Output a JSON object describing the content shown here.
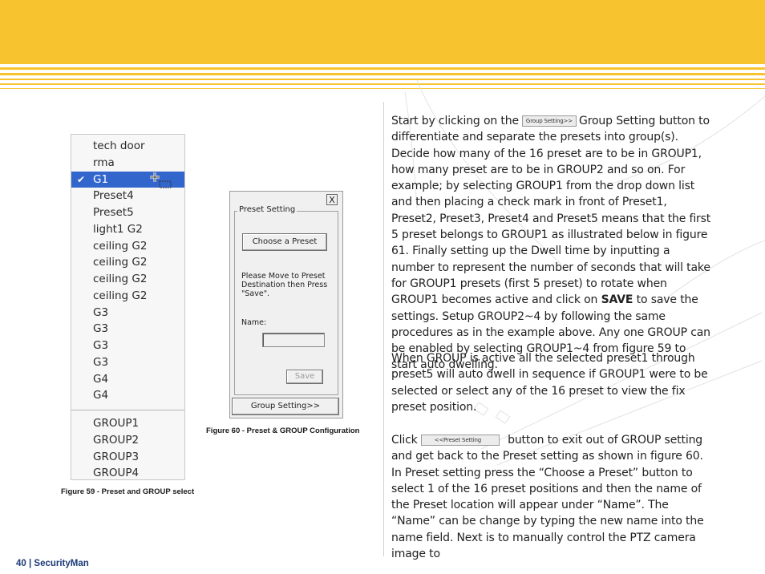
{
  "colors": {
    "banner": "#f7c32e",
    "selection": "#3366cc",
    "footer_text": "#1b3a78"
  },
  "figure59": {
    "menu_items": [
      {
        "label": "tech door",
        "checked": false,
        "selected": false
      },
      {
        "label": "rma",
        "checked": false,
        "selected": false
      },
      {
        "label": "G1",
        "checked": true,
        "selected": true
      },
      {
        "label": "Preset4",
        "checked": false,
        "selected": false
      },
      {
        "label": "Preset5",
        "checked": false,
        "selected": false
      },
      {
        "label": "light1 G2",
        "checked": false,
        "selected": false
      },
      {
        "label": "ceiling G2",
        "checked": false,
        "selected": false
      },
      {
        "label": "ceiling G2",
        "checked": false,
        "selected": false
      },
      {
        "label": "ceiling G2",
        "checked": false,
        "selected": false
      },
      {
        "label": "ceiling G2",
        "checked": false,
        "selected": false
      },
      {
        "label": "G3",
        "checked": false,
        "selected": false
      },
      {
        "label": "G3",
        "checked": false,
        "selected": false
      },
      {
        "label": "G3",
        "checked": false,
        "selected": false
      },
      {
        "label": "G3",
        "checked": false,
        "selected": false
      },
      {
        "label": "G4",
        "checked": false,
        "selected": false
      },
      {
        "label": "G4",
        "checked": false,
        "selected": false
      }
    ],
    "group_items": [
      "GROUP1",
      "GROUP2",
      "GROUP3",
      "GROUP4"
    ],
    "check_icon": "checkmark-icon",
    "caption": "Figure 59 - Preset and GROUP select"
  },
  "figure60": {
    "close_label": "X",
    "group_label": "Preset Setting",
    "choose_button": "Choose a Preset",
    "message": "Please Move to Preset Destination then Press \"Save\".",
    "name_label": "Name:",
    "name_value": "",
    "save_button": "Save",
    "group_setting_button": "Group Setting>>",
    "caption": "Figure 60 - Preset & GROUP Configuration"
  },
  "text": {
    "p1_a": "Start by clicking on the",
    "p1_btn": "Group Setting>>",
    "p1_b": "Group Setting button to differentiate and separate the presets into group(s).  Decide how many of the 16 preset are to be in GROUP1, how many preset are to be in GROUP2 and so on.  For example; by selecting GROUP1 from the drop down list and then placing a check mark in front of Preset1, Preset2, Preset3, Preset4 and Preset5 means that the first 5 preset belongs to GROUP1 as illustrated below in figure 61.  Finally setting up the Dwell time by inputting a number to represent the number of seconds that will take for GROUP1 presets (first 5 preset) to rotate when GROUP1 becomes active and click on",
    "p1_bold": "SAVE",
    "p1_c": "to save the settings.  Setup GROUP2~4 by following the same procedures as in the example above. Any one GROUP can be enabled by selecting GROUP1~4 from figure 59 to start auto dwelling.",
    "p2": "When GROUP is active all the selected preset1 through preset5 will auto dwell in sequence if GROUP1 were to be selected or select any of the 16 preset to view the fix preset position.",
    "p3_a": "Click",
    "p3_btn": "<<Preset Setting",
    "p3_b": "button to exit out of GROUP setting and get back to the Preset setting as shown in figure 60. In Preset setting press the “Choose a Preset” button to select 1 of the 16 preset positions and then the name of the Preset location will appear under “Name”.  The “Name” can be change by typing the new name into the name field.  Next is to manually control the PTZ camera image to"
  },
  "footer": "40  | SecurityMan"
}
